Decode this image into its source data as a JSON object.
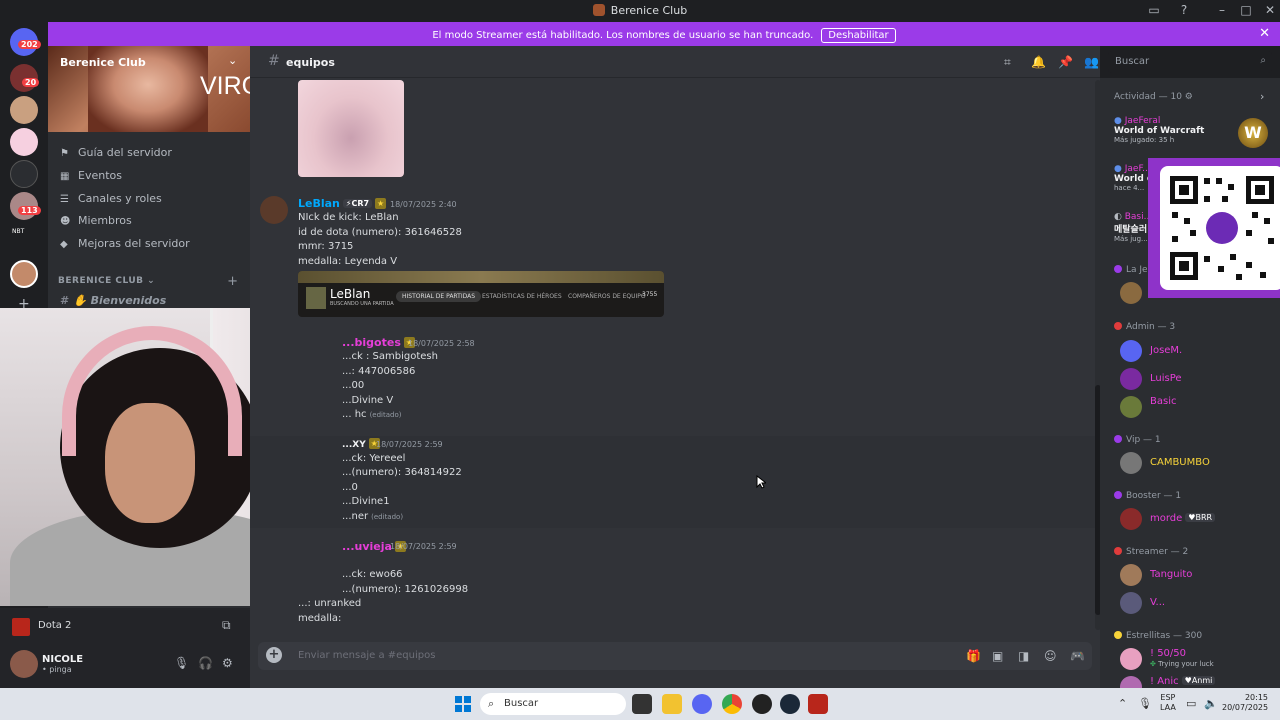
{
  "window": {
    "title": "Berenice Club"
  },
  "banner": {
    "text": "El modo Streamer está habilitado. Los nombres de usuario se han truncado.",
    "button": "Deshabilitar"
  },
  "servers": {
    "badges": [
      "202",
      "20",
      "113"
    ],
    "label_nbt": "NBT"
  },
  "server": {
    "name": "Berenice Club",
    "overlay_text": "VIRGEN"
  },
  "sidebar": {
    "items": [
      {
        "icon": "guide-icon",
        "label": "Guía del servidor"
      },
      {
        "icon": "calendar-icon",
        "label": "Eventos"
      },
      {
        "icon": "list-icon",
        "label": "Canales y roles"
      },
      {
        "icon": "members-icon",
        "label": "Miembros"
      },
      {
        "icon": "boost-icon",
        "label": "Mejoras del servidor"
      }
    ],
    "category": "BERENICE CLUB",
    "channel": "Bienvenidos"
  },
  "activity": {
    "game": "Dota 2"
  },
  "user": {
    "name": "NICOLE",
    "status": "• pinga"
  },
  "channel": {
    "name": "equipos"
  },
  "search": {
    "placeholder": "Buscar"
  },
  "messages": [
    {
      "user": "LeBlan",
      "tag": "⚡CR7",
      "time": "18/07/2025 2:40",
      "color": "#00a8fc",
      "lines": [
        "NIck de kick: LeBlan",
        "id de dota (numero): 361646528",
        "mmr: 3715",
        "medalla: Leyenda V"
      ]
    },
    {
      "user": "...bigotes",
      "time": "18/07/2025 2:58",
      "color": "#e63ed8",
      "lines": [
        "...ck : Sambigotesh",
        "...: 447006586",
        "...00",
        "...Divine V",
        "... hc"
      ],
      "edited": "(editado)"
    },
    {
      "user": "...XY",
      "time": "18/07/2025 2:59",
      "color": "#f2f3f5",
      "lines": [
        "...ck: Yereeel",
        "...(numero):  364814922",
        "...0",
        "...Divine1",
        "...ner"
      ],
      "edited": "(editado)"
    },
    {
      "user": "...uvieja",
      "time": "18/07/2025 2:59",
      "color": "#e63ed8",
      "lines": [
        "...ck: ewo66",
        "...(numero):  1261026998",
        "...: unranked",
        "medalla:"
      ]
    }
  ],
  "embed": {
    "name": "LeBlan",
    "subtitle": "BUSCANDO UNA PARTIDA",
    "tabs": [
      "HISTORIAL DE PARTIDAS",
      "ESTADÍSTICAS DE HÉROES",
      "COMPAÑEROS DE EQUIPO"
    ],
    "number": "3755"
  },
  "composer": {
    "placeholder": "Enviar mensaje a #equipos"
  },
  "members": {
    "activity_header": "Actividad — 10",
    "activity": [
      {
        "user": "JaeFeral",
        "game": "World of Warcraft",
        "time": "Más jugado: 35 h"
      },
      {
        "user": "JaeF...",
        "game": "World of...",
        "time": "hace 4..."
      },
      {
        "user": "Basi...",
        "game": "메탈슬러...",
        "time": "Más jug..."
      }
    ],
    "groups": [
      {
        "title": "La Je...",
        "members": []
      },
      {
        "title": "Admin — 3",
        "members": [
          {
            "name": "JoseM.",
            "color": "#e63ed8"
          },
          {
            "name": "LuisPe",
            "color": "#e63ed8"
          },
          {
            "name": "Basic",
            "color": "#e63ed8"
          }
        ]
      },
      {
        "title": "Vip — 1",
        "members": [
          {
            "name": "CAMBUMBO",
            "color": "#f7d33a"
          }
        ]
      },
      {
        "title": "Booster — 1",
        "members": [
          {
            "name": "morde",
            "color": "#e63ed8",
            "tag": "BRR"
          }
        ]
      },
      {
        "title": "Streamer — 2",
        "members": [
          {
            "name": "Tanguito",
            "color": "#e63ed8"
          },
          {
            "name": "V...",
            "color": "#e63ed8"
          }
        ]
      },
      {
        "title": "Estrellitas — 300",
        "members": [
          {
            "name": "! 50/50",
            "color": "#e63ed8",
            "sub": "Trying your luck"
          },
          {
            "name": "! Anic",
            "color": "#e63ed8",
            "tag": "Anmi"
          }
        ]
      }
    ]
  },
  "taskbar": {
    "search": "Buscar",
    "lang1": "ESP",
    "lang2": "LAA",
    "time": "20:15",
    "date": "20/07/2025"
  }
}
